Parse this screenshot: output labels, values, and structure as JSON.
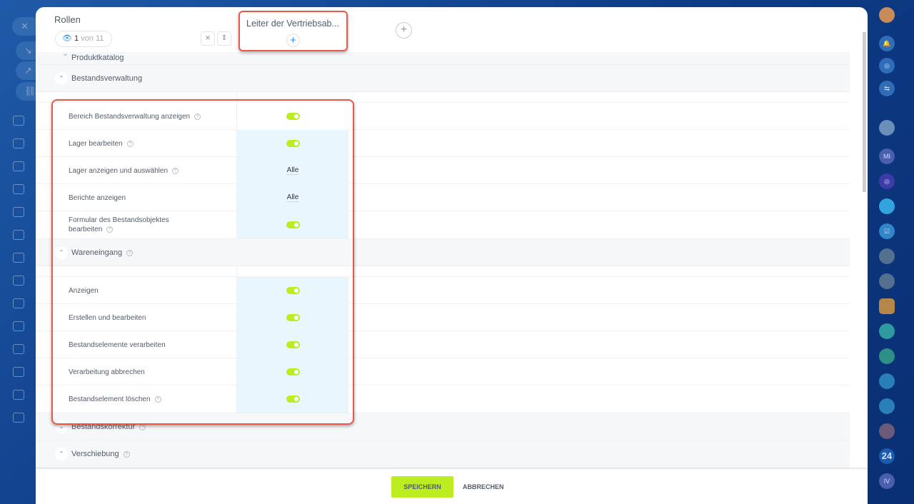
{
  "header": {
    "title": "Rollen",
    "counter_current": "1",
    "counter_total": "von 11",
    "role_name": "Leiter der Vertriebsab...",
    "add_label": "+",
    "add_role_label": "+"
  },
  "sections": [
    {
      "title": "Produktkatalog",
      "state": "collapsed"
    },
    {
      "title": "Bestandsverwaltung",
      "state": "expanded",
      "rows": [
        {
          "label": "Bereich Bestandsverwaltung anzeigen",
          "type": "toggle",
          "on": true
        },
        {
          "label": "Lager bearbeiten",
          "type": "toggle",
          "on": true
        },
        {
          "label": "Lager anzeigen und auswählen",
          "type": "select",
          "value": "Alle"
        },
        {
          "label": "Berichte anzeigen",
          "type": "select",
          "value": "Alle"
        },
        {
          "label": "Formular des Bestandsobjektes bearbeiten",
          "type": "toggle",
          "on": true
        }
      ]
    },
    {
      "title": "Wareneingang",
      "state": "expanded",
      "rows": [
        {
          "label": "Anzeigen",
          "type": "toggle",
          "on": true
        },
        {
          "label": "Erstellen und bearbeiten",
          "type": "toggle",
          "on": true
        },
        {
          "label": "Bestandselemente verarbeiten",
          "type": "toggle",
          "on": true
        },
        {
          "label": "Verarbeitung abbrechen",
          "type": "toggle",
          "on": true
        },
        {
          "label": "Bestandselement löschen",
          "type": "toggle",
          "on": true
        }
      ]
    },
    {
      "title": "Bestandskorrektur",
      "state": "collapsed"
    },
    {
      "title": "Verschiebung",
      "state": "expanded"
    }
  ],
  "footer": {
    "save": "SPEICHERN",
    "cancel": "ABBRECHEN"
  },
  "rightbar": {
    "mi": "MI",
    "num": "24",
    "iv": "IV"
  },
  "colors": {
    "accent": "#bbed21",
    "highlight": "#e8584d",
    "cell": "#eaf6fd"
  }
}
